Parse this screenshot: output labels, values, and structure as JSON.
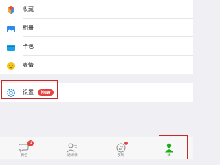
{
  "menu": {
    "items": [
      {
        "label": "收藏",
        "icon": "favorites-icon"
      },
      {
        "label": "相册",
        "icon": "album-icon"
      },
      {
        "label": "卡包",
        "icon": "card-wallet-icon"
      },
      {
        "label": "表情",
        "icon": "sticker-icon"
      }
    ],
    "settings": {
      "label": "设置",
      "icon": "settings-icon",
      "badge": "New"
    }
  },
  "tabbar": {
    "tabs": [
      {
        "label": "微信",
        "icon": "chat-icon",
        "badge": "4"
      },
      {
        "label": "通讯录",
        "icon": "contacts-icon"
      },
      {
        "label": "发现",
        "icon": "discover-icon"
      },
      {
        "label": "我",
        "icon": "me-icon",
        "active": true
      }
    ]
  },
  "colors": {
    "accent": "#1aad19",
    "badge": "#e64340",
    "highlight": "#c52a2a"
  }
}
